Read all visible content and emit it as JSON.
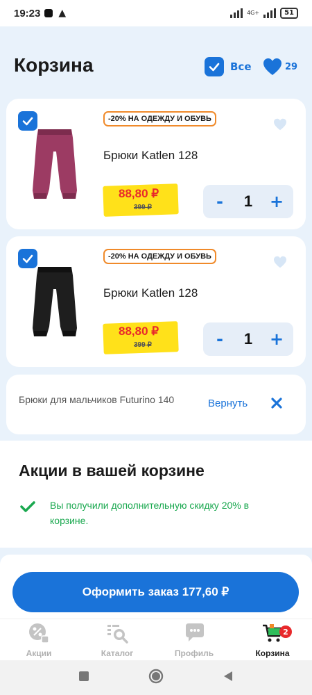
{
  "status": {
    "time": "19:23",
    "network": "4G+",
    "battery": "51"
  },
  "header": {
    "title": "Корзина",
    "select_all": "Все",
    "favorites_count": "29"
  },
  "items": [
    {
      "promo": "-20% НА ОДЕЖДУ И ОБУВЬ",
      "name": "Брюки Katlen 128",
      "price": "88,80 ₽",
      "old_price": "399 ₽",
      "quantity": "1",
      "color": "#9c3b63"
    },
    {
      "promo": "-20% НА ОДЕЖДУ И ОБУВЬ",
      "name": "Брюки Katlen 128",
      "price": "88,80 ₽",
      "old_price": "399 ₽",
      "quantity": "1",
      "color": "#1e1e1e"
    }
  ],
  "qty_controls": {
    "minus": "-",
    "plus": "+"
  },
  "removed": {
    "name": "Брюки для мальчиков Futurino 140",
    "restore_label": "Вернуть"
  },
  "promotions": {
    "title": "Акции в вашей корзине",
    "text": "Вы получили дополнительную скидку 20% в корзине."
  },
  "checkout": {
    "label": "Оформить заказ 177,60 ₽"
  },
  "tabs": [
    {
      "label": "Акции"
    },
    {
      "label": "Каталог"
    },
    {
      "label": "Профиль"
    },
    {
      "label": "Корзина",
      "badge": "2"
    }
  ],
  "colors": {
    "accent": "#1a73d9",
    "price": "#e8282b",
    "price_tag": "#ffe11a",
    "promo_border": "#f08a2a",
    "success": "#1aa84f"
  }
}
